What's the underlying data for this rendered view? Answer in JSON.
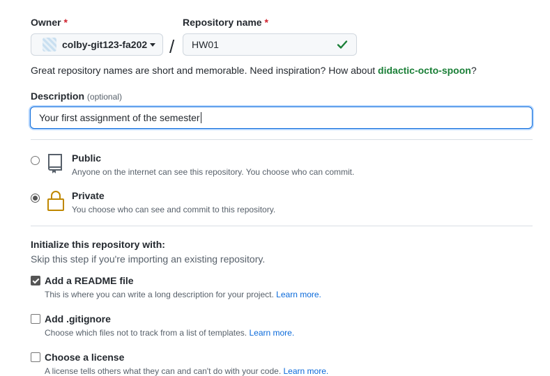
{
  "owner": {
    "label": "Owner",
    "required_mark": "*",
    "value": "colby-git123-fa202"
  },
  "separator": "/",
  "repo": {
    "label": "Repository name",
    "required_mark": "*",
    "value": "HW01"
  },
  "hint": {
    "text": "Great repository names are short and memorable. Need inspiration? How about ",
    "suggestion": "didactic-octo-spoon",
    "suffix": "?"
  },
  "description": {
    "label": "Description",
    "optional": "(optional)",
    "value": "Your first assignment of the semester"
  },
  "visibility": {
    "public": {
      "title": "Public",
      "subtitle": "Anyone on the internet can see this repository. You choose who can commit.",
      "checked": false,
      "icon": "repo-icon"
    },
    "private": {
      "title": "Private",
      "subtitle": "You choose who can see and commit to this repository.",
      "checked": true,
      "icon": "lock-icon"
    }
  },
  "init": {
    "title": "Initialize this repository with:",
    "subtitle": "Skip this step if you're importing an existing repository.",
    "readme": {
      "title": "Add a README file",
      "desc": "This is where you can write a long description for your project.",
      "link": "Learn more.",
      "checked": true
    },
    "gitignore": {
      "title": "Add .gitignore",
      "desc": "Choose which files not to track from a list of templates.",
      "link": "Learn more.",
      "checked": false
    },
    "license": {
      "title": "Choose a license",
      "desc": "A license tells others what they can and can't do with your code.",
      "link": "Learn more.",
      "checked": false
    }
  },
  "colors": {
    "success": "#1a7f37",
    "link": "#0969da",
    "lock": "#bf8700"
  }
}
